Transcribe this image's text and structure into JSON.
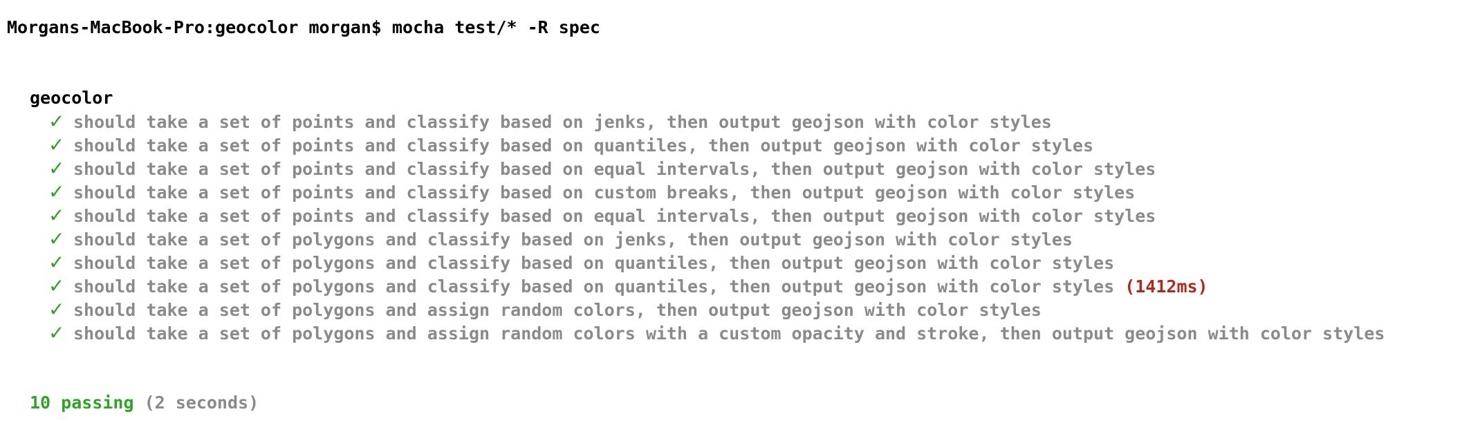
{
  "terminal": {
    "prompt": "Morgans-MacBook-Pro:geocolor morgan$ mocha test/* -R spec"
  },
  "suite": {
    "title": "geocolor",
    "tests": [
      {
        "mark": "✓",
        "title": "should take a set of points and classify based on jenks, then output geojson with color styles",
        "duration": ""
      },
      {
        "mark": "✓",
        "title": "should take a set of points and classify based on quantiles, then output geojson with color styles",
        "duration": ""
      },
      {
        "mark": "✓",
        "title": "should take a set of points and classify based on equal intervals, then output geojson with color styles",
        "duration": ""
      },
      {
        "mark": "✓",
        "title": "should take a set of points and classify based on custom breaks, then output geojson with color styles",
        "duration": ""
      },
      {
        "mark": "✓",
        "title": "should take a set of points and classify based on equal intervals, then output geojson with color styles",
        "duration": ""
      },
      {
        "mark": "✓",
        "title": "should take a set of polygons and classify based on jenks, then output geojson with color styles",
        "duration": ""
      },
      {
        "mark": "✓",
        "title": "should take a set of polygons and classify based on quantiles, then output geojson with color styles",
        "duration": ""
      },
      {
        "mark": "✓",
        "title": "should take a set of polygons and classify based on quantiles, then output geojson with color styles",
        "duration": "(1412ms)"
      },
      {
        "mark": "✓",
        "title": "should take a set of polygons and assign random colors, then output geojson with color styles",
        "duration": ""
      },
      {
        "mark": "✓",
        "title": "should take a set of polygons and assign random colors with a custom opacity and stroke, then output geojson with color styles",
        "duration": ""
      }
    ]
  },
  "summary": {
    "passing": "10 passing",
    "elapsed": "(2 seconds)"
  },
  "colors": {
    "pass": "#2fa324",
    "muted": "#8a8a8a",
    "slow": "#b0281b"
  }
}
